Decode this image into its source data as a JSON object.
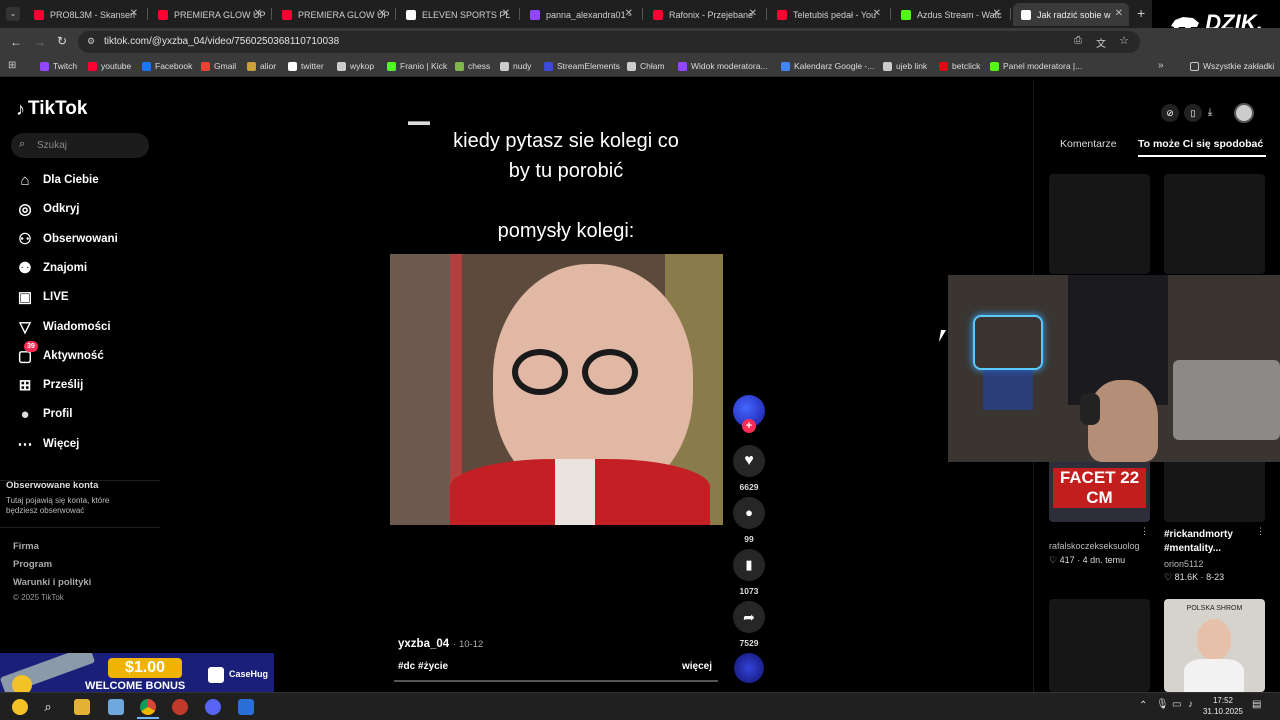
{
  "browser": {
    "tabs": [
      {
        "title": "PRO8L3M - Skansen",
        "favicon_color": "#ff0033"
      },
      {
        "title": "PREMIERA GLOW UP",
        "favicon_color": "#ff0033"
      },
      {
        "title": "PREMIERA GLOW UP",
        "favicon_color": "#ff0033"
      },
      {
        "title": "ELEVEN SPORTS PL",
        "favicon_color": "#ffffff"
      },
      {
        "title": "panna_alexandra01 -",
        "favicon_color": "#9146ff"
      },
      {
        "title": "Rafonix - Przejebane",
        "favicon_color": "#ff0033"
      },
      {
        "title": "Teletubiś pedał - You",
        "favicon_color": "#ff0033"
      },
      {
        "title": "Azdus Stream - Watc",
        "favicon_color": "#53fc18"
      },
      {
        "title": "Jak radzić sobie w",
        "favicon_color": "#ffffff"
      }
    ],
    "url": "tiktok.com/@yxzba_04/video/7560250368110710038",
    "bookmarks": [
      {
        "label": "Twitch",
        "color": "#9146ff"
      },
      {
        "label": "youtube",
        "color": "#ff0033"
      },
      {
        "label": "Facebook",
        "color": "#1877f2"
      },
      {
        "label": "Gmail",
        "color": "#ea4335"
      },
      {
        "label": "alior",
        "color": "#c8a13a"
      },
      {
        "label": "twitter",
        "color": "#ffffff"
      },
      {
        "label": "wykop",
        "color": "#cccccc"
      },
      {
        "label": "Franio | Kick",
        "color": "#53fc18"
      },
      {
        "label": "chess",
        "color": "#81b64c"
      },
      {
        "label": "nudy",
        "color": "#cccccc"
      },
      {
        "label": "StreamElements",
        "color": "#3b4bd8"
      },
      {
        "label": "Chłam",
        "color": "#cccccc"
      },
      {
        "label": "Widok moderatora...",
        "color": "#9146ff"
      },
      {
        "label": "Kalendarz Google -...",
        "color": "#4285f4"
      },
      {
        "label": "ujeb link",
        "color": "#cccccc"
      },
      {
        "label": "betclick",
        "color": "#e30613"
      },
      {
        "label": "Panel moderatora |...",
        "color": "#53fc18"
      }
    ],
    "all_bookmarks": "Wszystkie zakładki"
  },
  "overlay": {
    "brand": "DZIK."
  },
  "tiktok": {
    "logo": "TikTok",
    "search_placeholder": "Szukaj",
    "nav": [
      {
        "label": "Dla Ciebie",
        "icon": "home-icon"
      },
      {
        "label": "Odkryj",
        "icon": "compass-icon"
      },
      {
        "label": "Obserwowani",
        "icon": "user-follow-icon"
      },
      {
        "label": "Znajomi",
        "icon": "friends-icon"
      },
      {
        "label": "LIVE",
        "icon": "live-icon"
      },
      {
        "label": "Wiadomości",
        "icon": "messages-icon"
      },
      {
        "label": "Aktywność",
        "icon": "activity-icon",
        "badge": "39"
      },
      {
        "label": "Prześlij",
        "icon": "upload-icon"
      },
      {
        "label": "Profil",
        "icon": "profile-icon"
      },
      {
        "label": "Więcej",
        "icon": "more-icon"
      }
    ],
    "followed_title": "Obserwowane konta",
    "followed_desc": "Tutaj pojawią się konta, które będziesz obserwować",
    "footer": [
      "Firma",
      "Program",
      "Warunki i polityki",
      "© 2025 TikTok"
    ],
    "video": {
      "caption_top_1": "kiedy pytasz sie kolegi co",
      "caption_top_2": "by tu porobić",
      "caption_mid": "pomysły kolegi:",
      "author": "yxzba_04",
      "date": "· 10-12",
      "tags": "#dc #życie",
      "more": "więcej",
      "likes": "6629",
      "comments": "99",
      "saves": "1073",
      "shares": "7529"
    },
    "right": {
      "tab_comments": "Komentarze",
      "tab_related": "To może Ci się spodobać",
      "thumb1_text": "FACET 22 CM",
      "card1_user": "rafalskoczekseksuolog",
      "card1_stats": "♡ 417 · 4 dn. temu",
      "card2_title": "#rickandmorty #mentality...",
      "card2_user": "orion5112",
      "card2_stats": "♡ 81.6K · 8-23",
      "thumb4_label": "POLSKA SHROM"
    }
  },
  "ad": {
    "amount": "$1.00",
    "text": "WELCOME BONUS",
    "brand": "CaseHug"
  },
  "taskbar": {
    "time": "17:52",
    "date": "31.10.2025"
  }
}
